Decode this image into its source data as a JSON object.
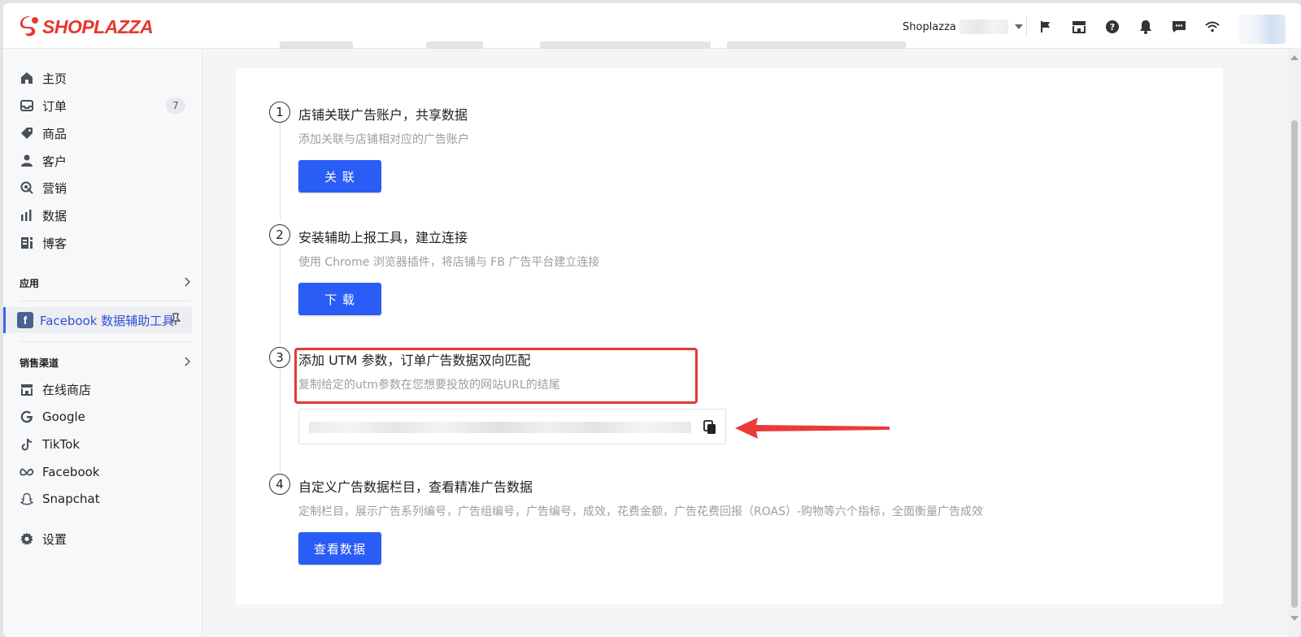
{
  "brand": {
    "logo_text": "SHOPLAZZA",
    "logo_color": "#e8362f"
  },
  "header": {
    "store_name": "Shoplazza",
    "icons": [
      "flag-icon",
      "store-icon",
      "help-icon",
      "bell-icon",
      "message-icon",
      "wifi-icon"
    ]
  },
  "sidebar": {
    "nav": [
      {
        "label": "主页",
        "icon": "home-icon"
      },
      {
        "label": "订单",
        "icon": "inbox-icon",
        "badge": "7"
      },
      {
        "label": "商品",
        "icon": "tag-icon"
      },
      {
        "label": "客户",
        "icon": "person-icon"
      },
      {
        "label": "营销",
        "icon": "marketing-icon"
      },
      {
        "label": "数据",
        "icon": "bar-chart-icon"
      },
      {
        "label": "博客",
        "icon": "blog-icon"
      }
    ],
    "apps_heading": "应用",
    "active_app": {
      "label": "Facebook 数据辅助工具",
      "icon": "facebook-icon"
    },
    "channels_heading": "销售渠道",
    "channels": [
      {
        "label": "在线商店",
        "icon": "store-icon"
      },
      {
        "label": "Google",
        "icon": "google-icon"
      },
      {
        "label": "TikTok",
        "icon": "tiktok-icon"
      },
      {
        "label": "Facebook",
        "icon": "meta-icon"
      },
      {
        "label": "Snapchat",
        "icon": "snapchat-icon"
      }
    ],
    "settings": {
      "label": "设置",
      "icon": "gear-icon"
    }
  },
  "steps": [
    {
      "num": "1",
      "title": "店铺关联广告账户，共享数据",
      "desc": "添加关联与店铺相对应的广告账户",
      "button": "关 联"
    },
    {
      "num": "2",
      "title": "安装辅助上报工具，建立连接",
      "desc": "使用 Chrome 浏览器插件，将店铺与 FB 广告平台建立连接",
      "button": "下 载"
    },
    {
      "num": "3",
      "title": "添加 UTM 参数，订单广告数据双向匹配",
      "desc": "复制给定的utm参数在您想要投放的网站URL的结尾"
    },
    {
      "num": "4",
      "title": "自定义广告数据栏目，查看精准广告数据",
      "desc": "定制栏目，展示广告系列编号，广告组编号，广告编号，成效，花费金额，广告花费回报（ROAS）-购物等六个指标，全面衡量广告成效",
      "button": "查看数据"
    }
  ],
  "colors": {
    "primary": "#2a5df5",
    "highlight": "#e83737",
    "active_nav": "#3050d8"
  }
}
